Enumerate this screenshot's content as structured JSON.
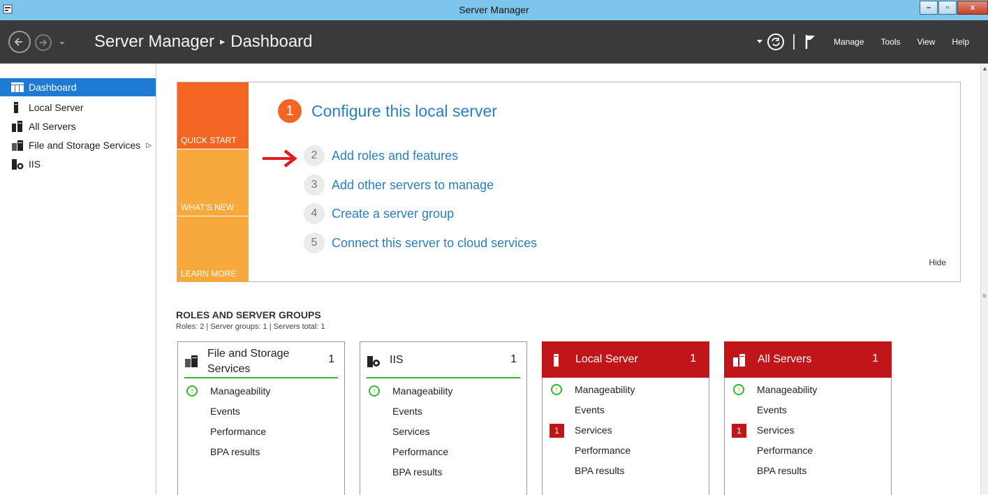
{
  "window": {
    "title": "Server Manager",
    "controls": {
      "minimize": "–",
      "restore": "▫",
      "close": "x"
    }
  },
  "header": {
    "breadcrumb_root": "Server Manager",
    "breadcrumb_sep": "▸",
    "breadcrumb_page": "Dashboard",
    "menu": {
      "manage": "Manage",
      "tools": "Tools",
      "view": "View",
      "help": "Help"
    }
  },
  "sidebar": {
    "items": [
      {
        "label": "Dashboard",
        "icon": "dashboard-icon",
        "active": true
      },
      {
        "label": "Local Server",
        "icon": "server-icon"
      },
      {
        "label": "All Servers",
        "icon": "servers-icon"
      },
      {
        "label": "File and Storage Services",
        "icon": "storage-icon",
        "arrow": "▷"
      },
      {
        "label": "IIS",
        "icon": "iis-icon"
      }
    ]
  },
  "quick_start": {
    "tiles": {
      "quick_start": "QUICK START",
      "whats_new": "WHAT'S NEW",
      "learn_more": "LEARN MORE"
    },
    "main_step": {
      "num": "1",
      "label": "Configure this local server"
    },
    "steps": [
      {
        "num": "2",
        "label": "Add roles and features"
      },
      {
        "num": "3",
        "label": "Add other servers to manage"
      },
      {
        "num": "4",
        "label": "Create a server group"
      },
      {
        "num": "5",
        "label": "Connect this server to cloud services"
      }
    ],
    "hide": "Hide"
  },
  "roles": {
    "title": "ROLES AND SERVER GROUPS",
    "summary": "Roles: 2   |   Server groups: 1   |   Servers total: 1",
    "cards": [
      {
        "title": "File and Storage Services",
        "count": "1",
        "rows": {
          "manageability": "Manageability",
          "events": "Events",
          "performance": "Performance",
          "bpa": "BPA results"
        }
      },
      {
        "title": "IIS",
        "count": "1",
        "rows": {
          "manageability": "Manageability",
          "events": "Events",
          "services": "Services",
          "performance": "Performance",
          "bpa": "BPA results"
        }
      },
      {
        "title": "Local Server",
        "count": "1",
        "rows": {
          "manageability": "Manageability",
          "events": "Events",
          "services_badge": "1",
          "services": "Services",
          "performance": "Performance",
          "bpa": "BPA results"
        }
      },
      {
        "title": "All Servers",
        "count": "1",
        "rows": {
          "manageability": "Manageability",
          "events": "Events",
          "services_badge": "1",
          "services": "Services",
          "performance": "Performance",
          "bpa": "BPA results"
        }
      }
    ]
  },
  "colors": {
    "accent_blue": "#1e7ad2",
    "tile_orange": "#f26522",
    "tile_yellow": "#f7a93d",
    "alert_red": "#c0161a",
    "ok_green": "#2db92d"
  }
}
